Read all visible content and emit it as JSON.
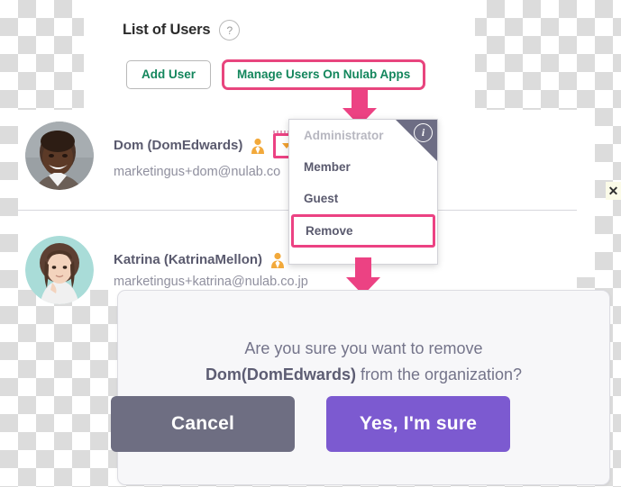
{
  "page": {
    "title": "List of Users",
    "help_icon_glyph": "?"
  },
  "toolbar": {
    "add_user_label": "Add User",
    "manage_users_label": "Manage Users On Nulab Apps",
    "link_color": "#13865c",
    "highlight_color": "#ec4283"
  },
  "users": [
    {
      "name": "Dom (DomEdwards)",
      "email": "marketingus+dom@nulab.co",
      "role_icon": "user-role-icon",
      "avatar_alt": "dom-avatar"
    },
    {
      "name": "Katrina (KatrinaMellon)",
      "email": "marketingus+katrina@nulab.co.jp",
      "role_icon": "user-role-icon",
      "avatar_alt": "katrina-avatar"
    }
  ],
  "role_menu": {
    "info_icon_glyph": "i",
    "items": [
      {
        "label": "Administrator",
        "state": "disabled"
      },
      {
        "label": "Member",
        "state": "enabled"
      },
      {
        "label": "Guest",
        "state": "enabled"
      },
      {
        "label": "Remove",
        "state": "highlighted"
      }
    ]
  },
  "confirm_dialog": {
    "line1": "Are you sure you want to remove",
    "subject": "Dom(DomEdwards)",
    "line2_suffix": " from the organization?",
    "cancel_label": "Cancel",
    "confirm_label": "Yes, I'm sure",
    "cancel_color": "#6e6e82",
    "confirm_color": "#7c5ad0"
  },
  "close_badge": {
    "glyph": "✕"
  }
}
